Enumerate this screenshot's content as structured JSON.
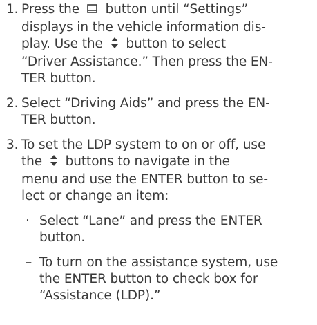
{
  "steps": [
    {
      "number": "1.",
      "lines": [
        {
          "parts": [
            "Press the ",
            "{icon:display-button}",
            " button until “Settings”"
          ]
        },
        {
          "parts": [
            "displays in the vehicle information dis-"
          ]
        },
        {
          "parts": [
            "play. Use the ",
            "{icon:updown}",
            " button to select"
          ]
        },
        {
          "parts": [
            "“Driver Assistance.” Then press the EN-"
          ]
        },
        {
          "parts": [
            "TER button."
          ]
        }
      ]
    },
    {
      "number": "2.",
      "lines": [
        {
          "parts": [
            "Select “Driving Aids” and press the EN-"
          ]
        },
        {
          "parts": [
            "TER button."
          ]
        }
      ]
    },
    {
      "number": "3.",
      "lines": [
        {
          "parts": [
            "To set the LDP system to on or off, use"
          ]
        },
        {
          "parts": [
            "the ",
            "{icon:updown}",
            " buttons to navigate in the"
          ]
        },
        {
          "parts": [
            "menu and use the ENTER button to se-"
          ]
        },
        {
          "parts": [
            "lect or change an item:"
          ]
        }
      ]
    }
  ],
  "subitems": [
    {
      "marker": "·",
      "lines": [
        {
          "parts": [
            "Select “Lane” and press the ENTER"
          ]
        },
        {
          "parts": [
            "button."
          ]
        }
      ]
    },
    {
      "marker": "–",
      "lines": [
        {
          "parts": [
            "To turn on the assistance system, use"
          ]
        },
        {
          "parts": [
            "the ENTER button to check box for"
          ]
        },
        {
          "parts": [
            "“Assistance (LDP).”"
          ]
        }
      ]
    }
  ]
}
